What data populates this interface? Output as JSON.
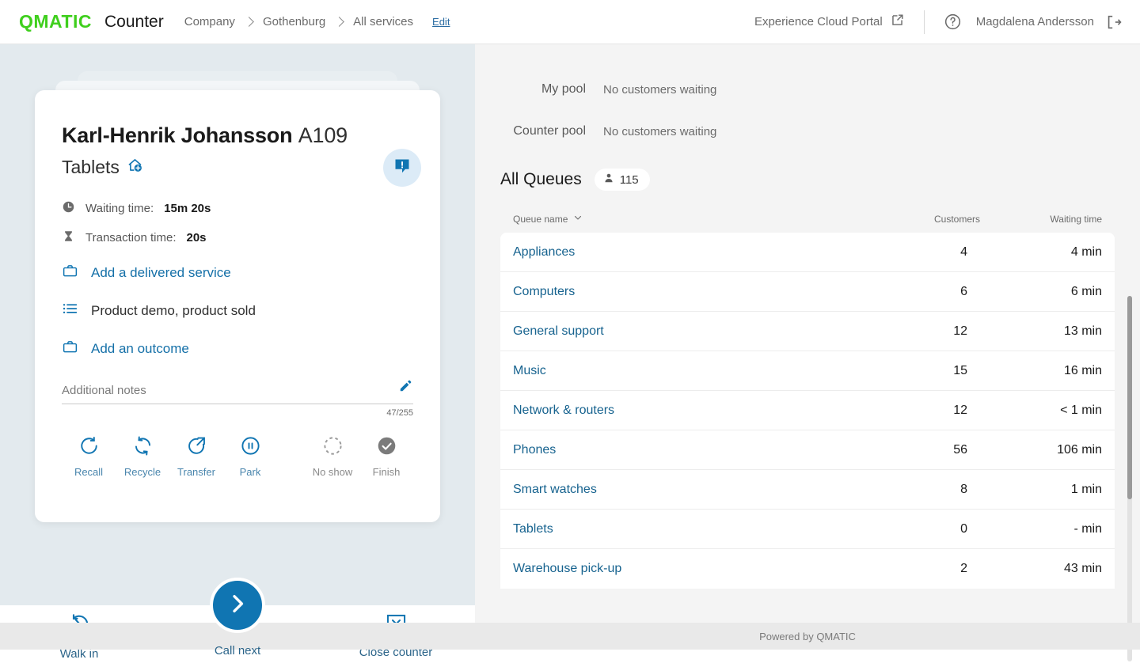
{
  "header": {
    "logo": "QMATIC",
    "app_title": "Counter",
    "breadcrumbs": [
      "Company",
      "Gothenburg",
      "All services"
    ],
    "edit_label": "Edit",
    "experience_cloud_portal": "Experience Cloud Portal",
    "user_name": "Magdalena Andersson",
    "icons": {
      "external_link": "external-link-icon",
      "help": "help-circle-icon",
      "logout": "logout-icon"
    }
  },
  "customer_card": {
    "name": "Karl-Henrik Johansson",
    "ticket": "A109",
    "service": "Tablets",
    "waiting_time_label": "Waiting time:",
    "waiting_time_value": "15m 20s",
    "transaction_time_label": "Transaction time:",
    "transaction_time_value": "20s",
    "links": [
      {
        "label": "Add a delivered service",
        "icon": "briefcase-icon",
        "style": "link"
      },
      {
        "label": "Product demo, product sold",
        "icon": "list-icon",
        "style": "text"
      },
      {
        "label": "Add an outcome",
        "icon": "briefcase-icon",
        "style": "link"
      }
    ],
    "notes_placeholder": "Additional notes",
    "notes_counter": "47/255",
    "actions": [
      {
        "label": "Recall",
        "icon": "recall-icon",
        "state": "active"
      },
      {
        "label": "Recycle",
        "icon": "recycle-icon",
        "state": "active"
      },
      {
        "label": "Transfer",
        "icon": "transfer-icon",
        "state": "active"
      },
      {
        "label": "Park",
        "icon": "park-icon",
        "state": "active"
      },
      {
        "label": "No show",
        "icon": "no-show-icon",
        "state": "disabled"
      },
      {
        "label": "Finish",
        "icon": "check-icon",
        "state": "disabled"
      }
    ]
  },
  "bottom_bar": {
    "walk_in": "Walk in",
    "call_next": "Call next",
    "close_counter": "Close counter"
  },
  "pools": [
    {
      "label": "My pool",
      "value": "No customers waiting"
    },
    {
      "label": "Counter pool",
      "value": "No customers waiting"
    }
  ],
  "queues": {
    "title": "All Queues",
    "total_badge": "115",
    "columns": {
      "name": "Queue name",
      "customers": "Customers",
      "waiting_time": "Waiting time"
    },
    "rows": [
      {
        "name": "Appliances",
        "customers": "4",
        "waiting": "4 min"
      },
      {
        "name": "Computers",
        "customers": "6",
        "waiting": "6 min"
      },
      {
        "name": "General support",
        "customers": "12",
        "waiting": "13 min"
      },
      {
        "name": "Music",
        "customers": "15",
        "waiting": "16 min"
      },
      {
        "name": "Network & routers",
        "customers": "12",
        "waiting": "< 1 min"
      },
      {
        "name": "Phones",
        "customers": "56",
        "waiting": "106 min"
      },
      {
        "name": "Smart watches",
        "customers": "8",
        "waiting": "1 min"
      },
      {
        "name": "Tablets",
        "customers": "0",
        "waiting": "- min"
      },
      {
        "name": "Warehouse pick-up",
        "customers": "2",
        "waiting": "43 min"
      }
    ]
  },
  "footer": {
    "text": "Powered by QMATIC"
  },
  "colors": {
    "brand_green": "#3fcf1d",
    "accent_blue": "#1075b2",
    "link_blue": "#17638f",
    "left_bg": "#e3eaee",
    "right_bg": "#f4f4f4",
    "disabled_grey": "#8a8a8a"
  }
}
